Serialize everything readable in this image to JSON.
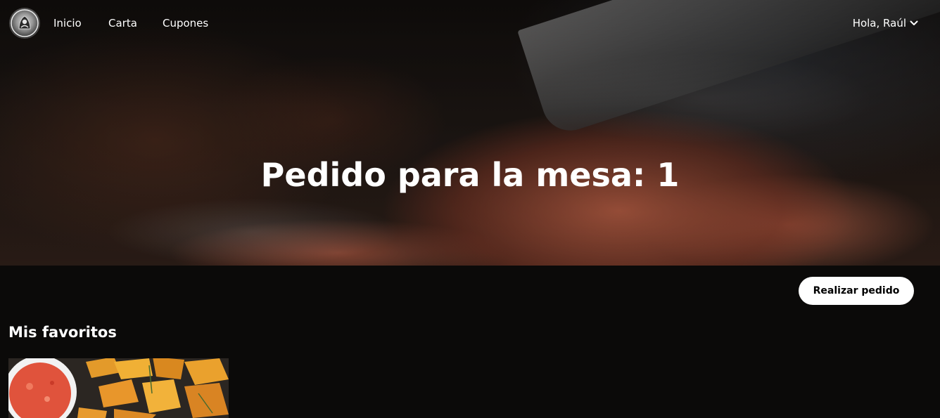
{
  "navbar": {
    "logo_icon": "restaurant-logo-icon",
    "links": [
      {
        "label": "Inicio"
      },
      {
        "label": "Carta"
      },
      {
        "label": "Cupones"
      }
    ],
    "user_greeting": "Hola, Raúl",
    "user_menu_icon": "chevron-down-icon"
  },
  "hero": {
    "title": "Pedido para la mesa: 1"
  },
  "actions": {
    "order_button_label": "Realizar pedido"
  },
  "favorites": {
    "section_title": "Mis favoritos",
    "items": [
      {
        "image": "potato-wedges-with-sauce-photo"
      }
    ]
  },
  "colors": {
    "page_background": "#0b0a09",
    "button_background": "#ffffff",
    "text": "#ffffff"
  }
}
